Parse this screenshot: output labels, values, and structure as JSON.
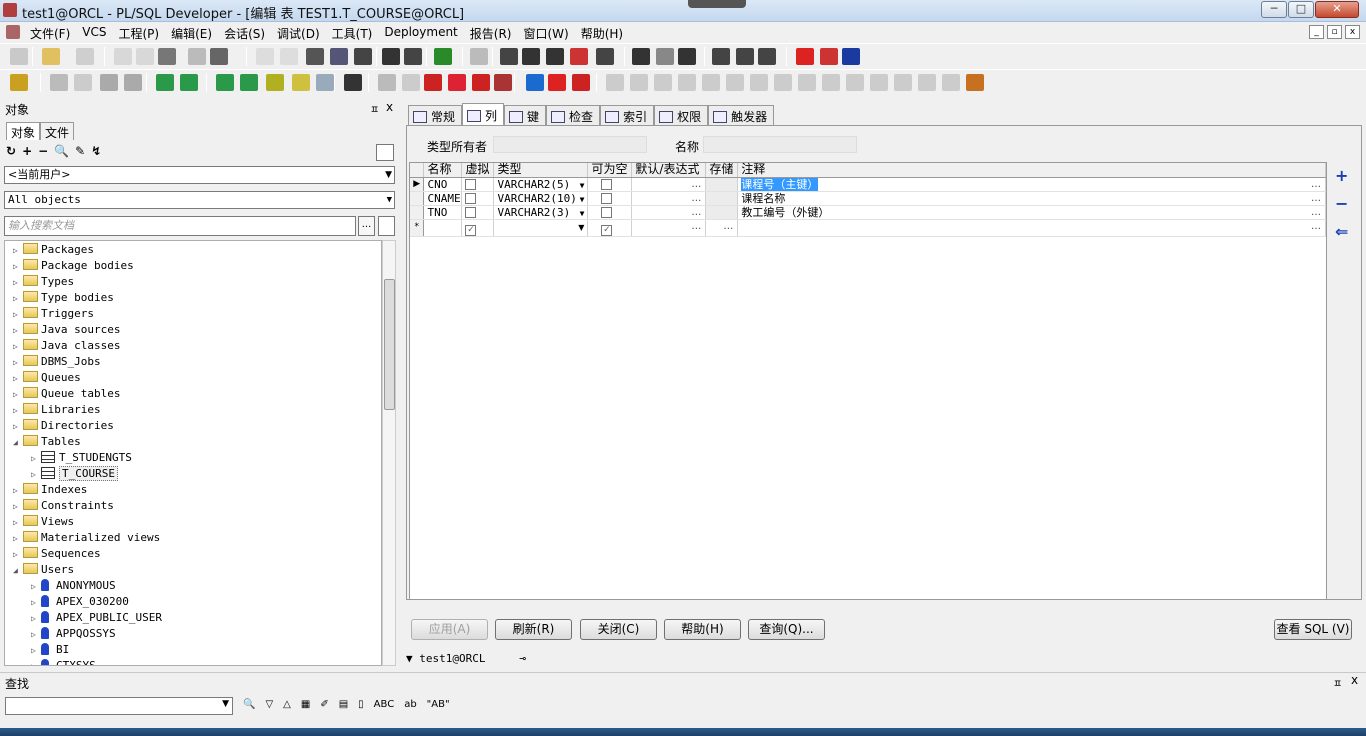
{
  "window": {
    "title": "test1@ORCL - PL/SQL Developer - [编辑 表 TEST1.T_COURSE@ORCL]",
    "min_label": "─",
    "max_label": "□",
    "close_label": "✕"
  },
  "menubar": {
    "items": [
      "文件(F)",
      "VCS",
      "工程(P)",
      "编辑(E)",
      "会话(S)",
      "调试(D)",
      "工具(T)",
      "Deployment",
      "报告(R)",
      "窗口(W)",
      "帮助(H)"
    ],
    "mdi_buttons": [
      "_",
      "▫",
      "x"
    ]
  },
  "object_panel": {
    "title": "对象",
    "pin": "ㅍ",
    "close": "x",
    "tabs": [
      "对象",
      "文件"
    ],
    "tools": [
      "↻",
      "+",
      "−",
      "🔍",
      "✎",
      "↯"
    ],
    "owner_combo": "<当前用户>",
    "filter_combo": "All objects",
    "search_placeholder": "输入搜索文档",
    "search_button": "...",
    "tree": [
      {
        "label": "Packages",
        "type": "folder",
        "expanded": false,
        "level": 0
      },
      {
        "label": "Package bodies",
        "type": "folder",
        "expanded": false,
        "level": 0
      },
      {
        "label": "Types",
        "type": "folder",
        "expanded": false,
        "level": 0
      },
      {
        "label": "Type bodies",
        "type": "folder",
        "expanded": false,
        "level": 0
      },
      {
        "label": "Triggers",
        "type": "folder",
        "expanded": false,
        "level": 0
      },
      {
        "label": "Java sources",
        "type": "folder",
        "expanded": false,
        "level": 0
      },
      {
        "label": "Java classes",
        "type": "folder",
        "expanded": false,
        "level": 0
      },
      {
        "label": "DBMS_Jobs",
        "type": "folder",
        "expanded": false,
        "level": 0
      },
      {
        "label": "Queues",
        "type": "folder",
        "expanded": false,
        "level": 0
      },
      {
        "label": "Queue tables",
        "type": "folder",
        "expanded": false,
        "level": 0
      },
      {
        "label": "Libraries",
        "type": "folder",
        "expanded": false,
        "level": 0
      },
      {
        "label": "Directories",
        "type": "folder",
        "expanded": false,
        "level": 0
      },
      {
        "label": "Tables",
        "type": "folder",
        "expanded": true,
        "level": 0
      },
      {
        "label": "T_STUDENGTS",
        "type": "table",
        "expanded": false,
        "level": 1
      },
      {
        "label": "T_COURSE",
        "type": "table",
        "expanded": false,
        "level": 1,
        "selected": true
      },
      {
        "label": "Indexes",
        "type": "folder",
        "expanded": false,
        "level": 0
      },
      {
        "label": "Constraints",
        "type": "folder",
        "expanded": false,
        "level": 0
      },
      {
        "label": "Views",
        "type": "folder",
        "expanded": false,
        "level": 0
      },
      {
        "label": "Materialized views",
        "type": "folder",
        "expanded": false,
        "level": 0
      },
      {
        "label": "Sequences",
        "type": "folder",
        "expanded": false,
        "level": 0
      },
      {
        "label": "Users",
        "type": "folder",
        "expanded": true,
        "level": 0
      },
      {
        "label": "ANONYMOUS",
        "type": "user",
        "expanded": false,
        "level": 1
      },
      {
        "label": "APEX_030200",
        "type": "user",
        "expanded": false,
        "level": 1
      },
      {
        "label": "APEX_PUBLIC_USER",
        "type": "user",
        "expanded": false,
        "level": 1
      },
      {
        "label": "APPQOSSYS",
        "type": "user",
        "expanded": false,
        "level": 1
      },
      {
        "label": "BI",
        "type": "user",
        "expanded": false,
        "level": 1
      },
      {
        "label": "CTXSYS",
        "type": "user",
        "expanded": false,
        "level": 1
      }
    ]
  },
  "editor": {
    "tabs": [
      "常规",
      "列",
      "键",
      "检查",
      "索引",
      "权限",
      "触发器"
    ],
    "active_tab": "列",
    "owner_label": "类型所有者",
    "name_label": "名称",
    "columns_header": [
      "名称",
      "虚拟",
      "类型",
      "可为空",
      "默认/表达式",
      "存储",
      "注释"
    ],
    "rows": [
      {
        "name": "CNO",
        "type": "VARCHAR2(5)",
        "comment": "课程号（主键）",
        "current": true
      },
      {
        "name": "CNAME",
        "type": "VARCHAR2(10)",
        "comment": "课程名称",
        "current": false
      },
      {
        "name": "TNO",
        "type": "VARCHAR2(3)",
        "comment": "教工编号（外键）",
        "current": false
      }
    ],
    "new_row_marker": "*",
    "current_row_marker": "▶",
    "side_buttons": [
      "+",
      "−",
      "⇐"
    ],
    "buttons": {
      "apply": "应用(A)",
      "refresh": "刷新(R)",
      "close": "关闭(C)",
      "help": "帮助(H)",
      "query": "查询(Q)...",
      "view_sql": "查看 SQL (V)"
    },
    "connection": "test1@ORCL"
  },
  "find_bar": {
    "title": "查找",
    "pin": "ㅍ",
    "close": "x",
    "tools": [
      "🔍",
      "▽",
      "△",
      "▦",
      "✐",
      "▤",
      "▯",
      "ABC",
      "ab",
      "\"AB\""
    ]
  }
}
